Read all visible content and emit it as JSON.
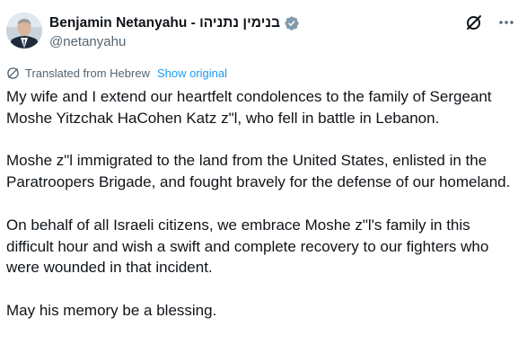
{
  "author": {
    "display_name": "Benjamin Netanyahu - בנימין נתניהו",
    "handle": "@netanyahu",
    "verified": true,
    "avatar_icon": "profile-photo",
    "verified_color": "#829aab"
  },
  "actions": {
    "grok_icon": "grok-icon",
    "more_icon": "more-dots-icon"
  },
  "translation": {
    "icon": "globe-icon",
    "label": "Translated from Hebrew",
    "show_original": "Show original",
    "link_color": "#1d9bf0"
  },
  "post": {
    "paragraphs": [
      "My wife and I extend our heartfelt condolences to the family of Sergeant Moshe Yitzchak HaCohen Katz z\"l, who fell in battle in Lebanon.",
      "Moshe z\"l immigrated to the land from the United States, enlisted in the Paratroopers Brigade, and fought bravely for the defense of our homeland.",
      "On behalf of all Israeli citizens, we embrace Moshe z\"l's family in this difficult hour and wish a swift and complete recovery to our fighters who were wounded in that incident.",
      "May his memory be a blessing."
    ]
  }
}
